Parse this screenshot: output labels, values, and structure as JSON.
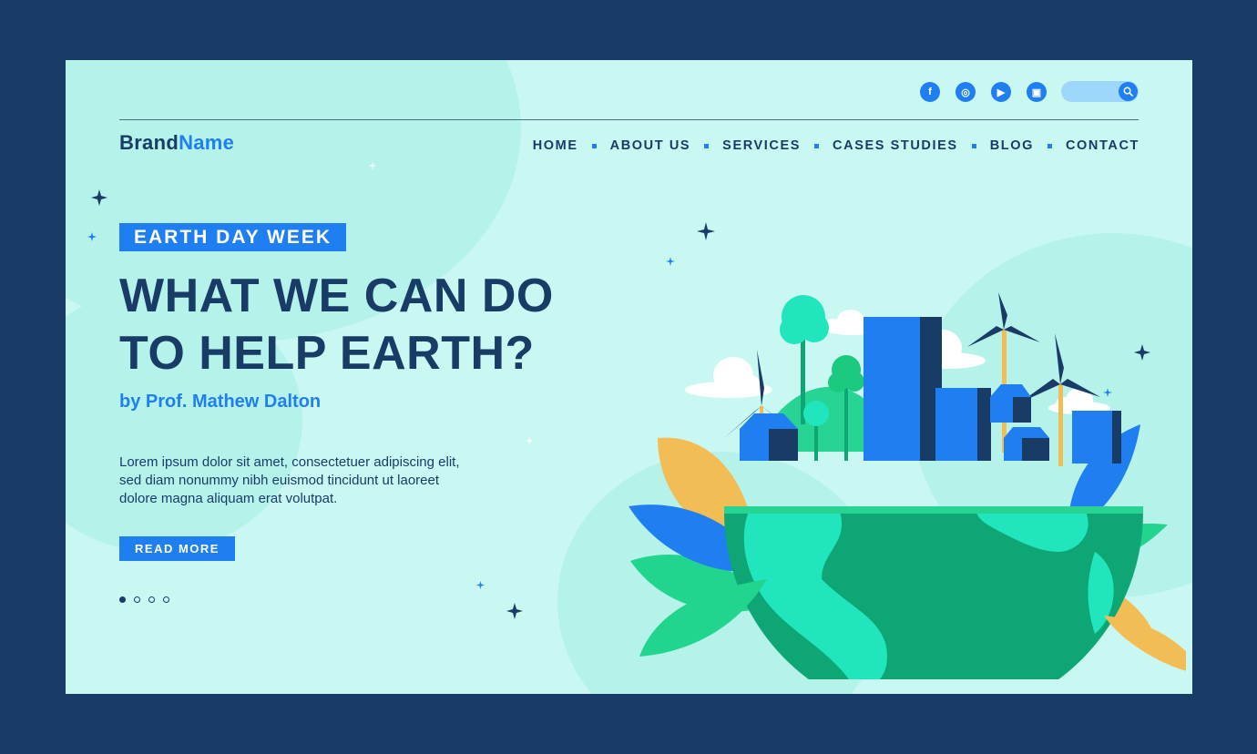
{
  "brand": {
    "part1": "Brand",
    "part2": "Name"
  },
  "social": [
    {
      "name": "facebook-icon",
      "glyph": "f"
    },
    {
      "name": "instagram-icon",
      "glyph": "◎"
    },
    {
      "name": "youtube-icon",
      "glyph": "▶"
    },
    {
      "name": "twitch-icon",
      "glyph": "▣"
    }
  ],
  "search": {
    "placeholder": "",
    "icon": "search-icon"
  },
  "nav": {
    "home": "HOME",
    "about": "ABOUT US",
    "services": "SERVICES",
    "cases": "CASES STUDIES",
    "blog": "BLOG",
    "contact": "CONTACT"
  },
  "hero": {
    "tag": "EARTH DAY WEEK",
    "title_line1": "WHAT WE CAN DO",
    "title_line2": "TO HELP EARTH?",
    "author": "by Prof. Mathew Dalton",
    "body_line1": "Lorem ipsum dolor sit amet, consectetuer adipiscing elit,",
    "body_line2": "sed diam nonummy nibh euismod tincidunt ut laoreet",
    "body_line3": "dolore magna aliquam erat volutpat.",
    "cta": "READ MORE"
  },
  "slider": {
    "count": 4,
    "active": 1
  },
  "colors": {
    "navy": "#183c66",
    "accent": "#1f7ff0",
    "background": "#c9f8f2",
    "earth_dark": "#0fa675",
    "earth_light": "#21e6bd"
  }
}
